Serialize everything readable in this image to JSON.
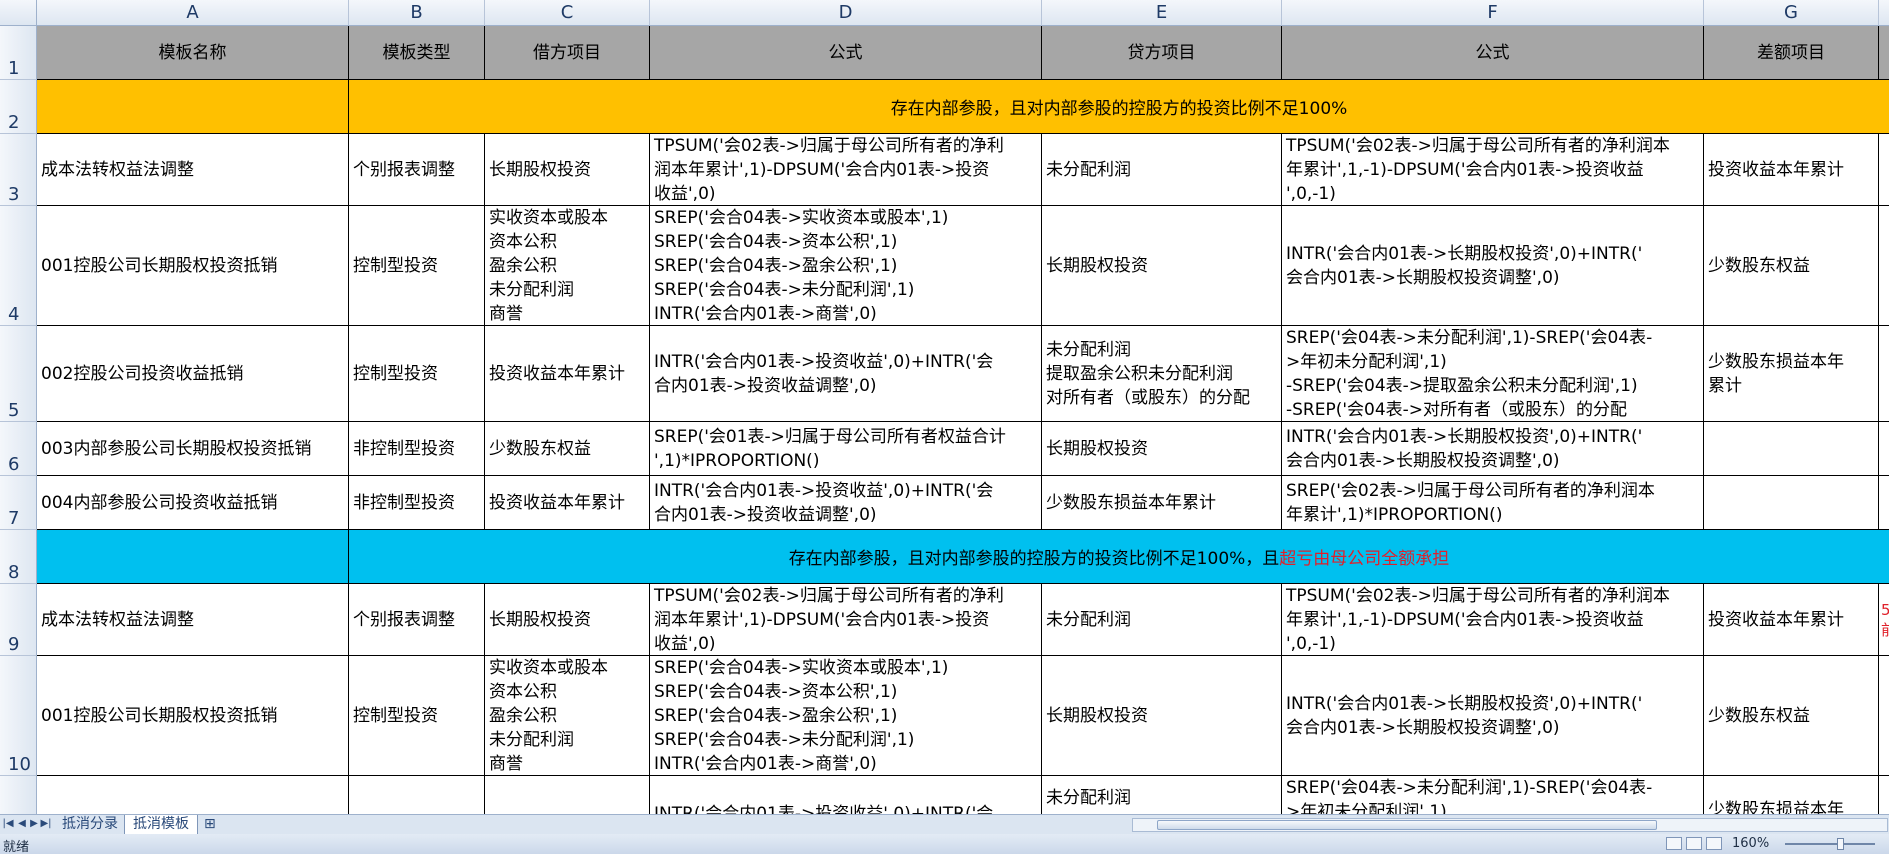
{
  "columns": [
    "A",
    "B",
    "C",
    "D",
    "E",
    "F",
    "G"
  ],
  "row_numbers": [
    "1",
    "2",
    "3",
    "4",
    "5",
    "6",
    "7",
    "8",
    "9",
    "10"
  ],
  "header": {
    "a": "模板名称",
    "b": "模板类型",
    "c": "借方项目",
    "d": "公式",
    "e": "贷方项目",
    "f": "公式",
    "g": "差额项目"
  },
  "section1": "存在内部参股，且对内部参股的控股方的投资比例不足100%",
  "section2": {
    "prefix": "存在内部参股，且对内部参股的控股方的投资比例不足100%，且",
    "highlight": "超亏由母公司全额承担"
  },
  "rows": {
    "r3": {
      "a": "成本法转权益法调整",
      "b": "个别报表调整",
      "c": "长期股权投资",
      "d": "TPSUM('会02表->归属于母公司所有者的净利\n润本年累计',1)-DPSUM('会合内01表->投资\n收益',0)",
      "e": "未分配利润",
      "f": "TPSUM('会02表->归属于母公司所有者的净利润本\n年累计',1,-1)-DPSUM('会合内01表->投资收益\n',0,-1)",
      "g": "投资收益本年累计"
    },
    "r4": {
      "a": "001控股公司长期股权投资抵销",
      "b": "控制型投资",
      "c": "实收资本或股本\n资本公积\n盈余公积\n未分配利润\n商誉",
      "d": "SREP('会合04表->实收资本或股本',1)\nSREP('会合04表->资本公积',1)\nSREP('会合04表->盈余公积',1)\nSREP('会合04表->未分配利润',1)\nINTR('会合内01表->商誉',0)",
      "e": "长期股权投资",
      "f": "INTR('会合内01表->长期股权投资',0)+INTR('\n会合内01表->长期股权投资调整',0)",
      "g": "少数股东权益"
    },
    "r5": {
      "a": "002控股公司投资收益抵销",
      "b": "控制型投资",
      "c": "投资收益本年累计",
      "d": "INTR('会合内01表->投资收益',0)+INTR('会\n合内01表->投资收益调整',0)",
      "e": "未分配利润\n提取盈余公积未分配利润\n对所有者（或股东）的分配",
      "f": "SREP('会04表->未分配利润',1)-SREP('会04表-\n>年初未分配利润',1)\n-SREP('会04表->提取盈余公积未分配利润',1)\n-SREP('会04表->对所有者（或股东）的分配",
      "g": "少数股东损益本年\n累计"
    },
    "r6": {
      "a": "003内部参股公司长期股权投资抵销",
      "b": "非控制型投资",
      "c": "少数股东权益",
      "d": "SREP('会01表->归属于母公司所有者权益合计\n',1)*IPROPORTION()",
      "e": "长期股权投资",
      "f": "INTR('会合内01表->长期股权投资',0)+INTR('\n会合内01表->长期股权投资调整',0)",
      "g": ""
    },
    "r7": {
      "a": "004内部参股公司投资收益抵销",
      "b": "非控制型投资",
      "c": "投资收益本年累计",
      "d": "INTR('会合内01表->投资收益',0)+INTR('会\n合内01表->投资收益调整',0)",
      "e": "少数股东损益本年累计",
      "f": "SREP('会02表->归属于母公司所有者的净利润本\n年累计',1)*IPROPORTION()",
      "g": ""
    },
    "r9": {
      "a": "成本法转权益法调整",
      "b": "个别报表调整",
      "c": "长期股权投资",
      "d": "TPSUM('会02表->归属于母公司所有者的净利\n润本年累计',1)-DPSUM('会合内01表->投资\n收益',0)",
      "e": "未分配利润",
      "f": "TPSUM('会02表->归属于母公司所有者的净利润本\n年累计',1,-1)-DPSUM('会合内01表->投资收益\n',0,-1)",
      "g": "投资收益本年累计",
      "h": "5\n前"
    },
    "r10": {
      "a": "001控股公司长期股权投资抵销",
      "b": "控制型投资",
      "c": "实收资本或股本\n资本公积\n盈余公积\n未分配利润\n商誉",
      "d": "SREP('会合04表->实收资本或股本',1)\nSREP('会合04表->资本公积',1)\nSREP('会合04表->盈余公积',1)\nSREP('会合04表->未分配利润',1)\nINTR('会合内01表->商誉',0)",
      "e": "长期股权投资",
      "f": "INTR('会合内01表->长期股权投资',0)+INTR('\n会合内01表->长期股权投资调整',0)",
      "g": "少数股东权益"
    },
    "r11": {
      "d": "INTR('会合内01表->投资收益',0)+INTR('会",
      "e": "未分配利润",
      "f": "SREP('会04表->未分配利润',1)-SREP('会04表-\n>年初未分配利润',1)",
      "g": "少数股东损益本年"
    }
  },
  "sheet_tabs": [
    "抵消分录",
    "抵消模板"
  ],
  "status": {
    "ready": "就绪",
    "zoom": "160%"
  },
  "colors": {
    "header_fill": "#a6a6a6",
    "band1": "#ffc000",
    "band2": "#00c0ef",
    "highlight_text": "#e0202a"
  }
}
